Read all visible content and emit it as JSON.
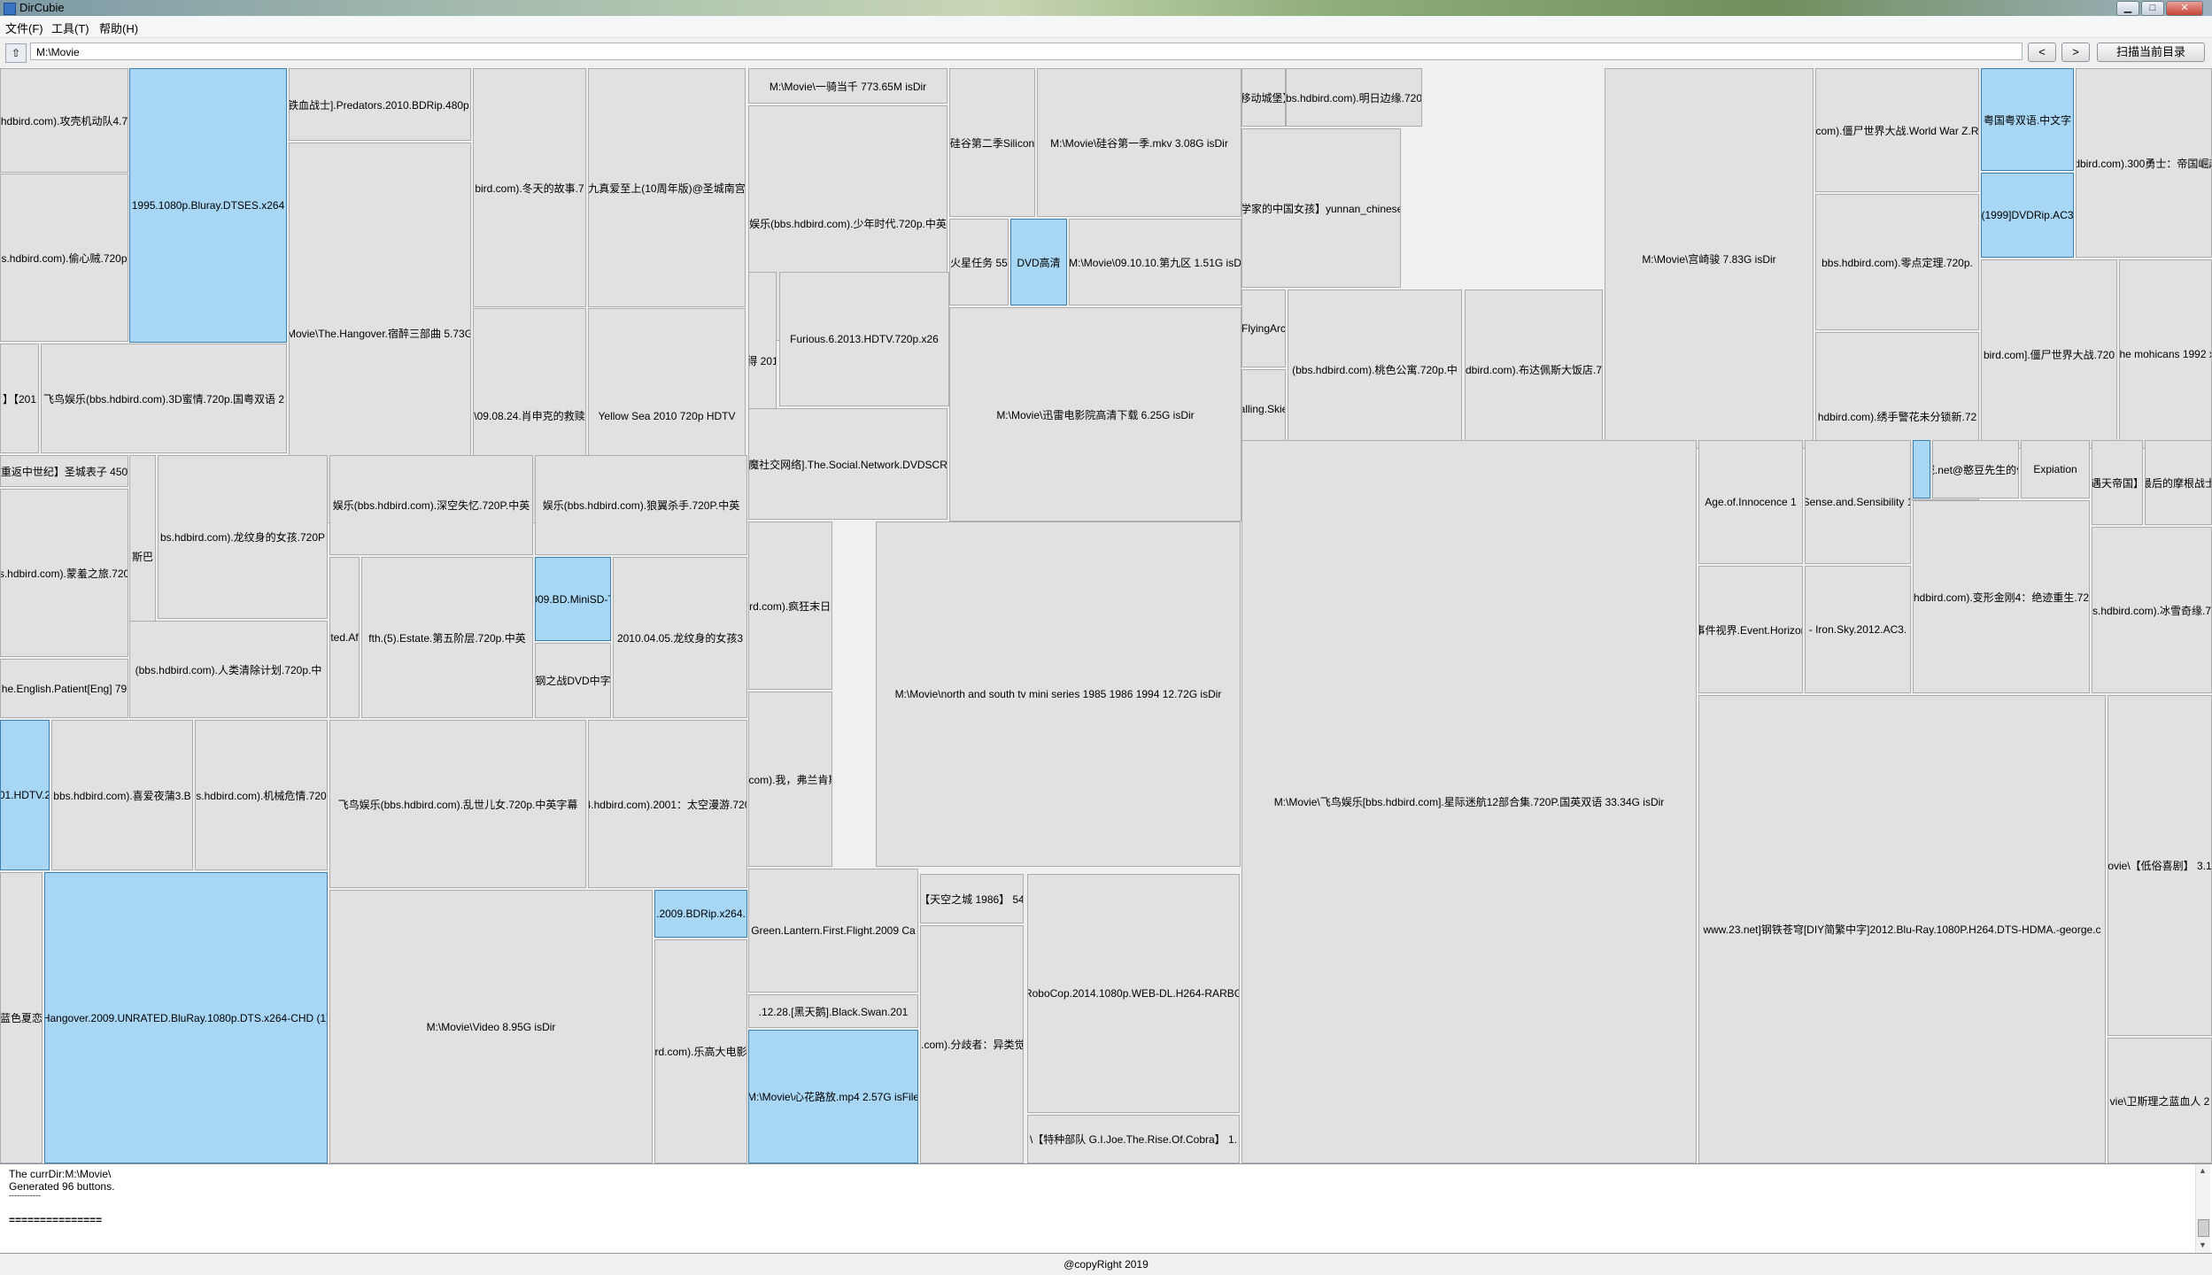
{
  "window": {
    "title": "DirCubie",
    "minimize": "▁",
    "maximize": "□",
    "close": "✕"
  },
  "menu": [
    "文件(F)",
    "工具(T)",
    "帮助(H)"
  ],
  "toolbar": {
    "address_icon": "folder-up-icon",
    "address_value": "M:\\Movie",
    "back_label": "<",
    "forward_label": ">",
    "scan_label": "扫描当前目录"
  },
  "tiles": [
    {
      "label": "hdbird.com).攻壳机动队4.7",
      "selected": false
    },
    {
      "label": "1995.1080p.Bluray.DTSES.x264",
      "selected": true
    },
    {
      "label": "铁血战士].Predators.2010.BDRip.480p.",
      "selected": false
    },
    {
      "label": "bird.com).冬天的故事.7",
      "selected": false
    },
    {
      "label": "九真爱至上(10周年版)@圣城南宫",
      "selected": false
    },
    {
      "label": "M:\\Movie\\一骑当千 773.65M isDir",
      "selected": false
    },
    {
      "label": "Movie\\The.Hangover.宿醉三部曲 5.73G",
      "selected": false
    },
    {
      "label": "娱乐(bbs.hdbird.com).少年时代.720p.中英",
      "selected": false
    },
    {
      "label": "s.hdbird.com).偷心贼.720p",
      "selected": false
    },
    {
      "label": "\\09.08.24.肖申克的救赎",
      "selected": false
    },
    {
      "label": "Yellow Sea 2010 720p HDTV",
      "selected": false
    },
    {
      "label": "】【201",
      "selected": false
    },
    {
      "label": "飞鸟娱乐(bbs.hdbird.com).3D蜜情.720p.国粤双语 2",
      "selected": false
    },
    {
      "label": "重返中世纪】圣城表子 450",
      "selected": false
    },
    {
      "label": "s.hdbird.com).蒙羞之旅.720",
      "selected": false
    },
    {
      "label": "斯巴",
      "selected": false
    },
    {
      "label": "bs.hdbird.com).龙纹身的女孩.720P",
      "selected": false
    },
    {
      "label": "娱乐(bbs.hdbird.com).深空失忆.720P.中英",
      "selected": false
    },
    {
      "label": "娱乐(bbs.hdbird.com).狼翼杀手.720P.中英",
      "selected": false
    },
    {
      "label": "ted.Af",
      "selected": false
    },
    {
      "label": "fth.(5).Estate.第五阶层.720p.中英",
      "selected": false
    },
    {
      "label": "009.BD.MiniSD-T",
      "selected": true
    },
    {
      "label": "2010.04.05.龙纹身的女孩3",
      "selected": false
    },
    {
      "label": "钢之战DVD中字",
      "selected": false
    },
    {
      "label": "(bbs.hdbird.com).人类清除计划.720p.中",
      "selected": false
    },
    {
      "label": "he.English.Patient[Eng] 79",
      "selected": false
    },
    {
      "label": "01.HDTV.2",
      "selected": true
    },
    {
      "label": "bbs.hdbird.com).喜爱夜蒲3.B",
      "selected": false
    },
    {
      "label": "s.hdbird.com).机械危情.720",
      "selected": false
    },
    {
      "label": "飞鸟娱乐(bbs.hdbird.com).乱世儿女.720p.中英字幕",
      "selected": false
    },
    {
      "label": "4.hdbird.com).2001：太空漫游.720",
      "selected": false
    },
    {
      "label": "Hangover.2009.UNRATED.BluRay.1080p.DTS.x264-CHD (1)",
      "selected": true
    },
    {
      "label": "M:\\Movie\\Video 8.95G isDir",
      "selected": false
    },
    {
      "label": ".2009.BDRip.x264.",
      "selected": true
    },
    {
      "label": "rd.com).乐高大电影",
      "selected": false
    },
    {
      "label": "蓝色夏恋",
      "selected": false
    },
    {
      "label": "M:\\Movie\\心花路放.mp4 2.57G isFile",
      "selected": true
    },
    {
      "label": "得 201",
      "selected": false
    },
    {
      "label": "Furious.6.2013.HDTV.720p.x26",
      "selected": false
    },
    {
      "label": "魔社交网络].The.Social.Network.DVDSCR",
      "selected": false
    },
    {
      "label": "hdbird.com).疯狂末日.720",
      "selected": false
    },
    {
      "label": "M:\\Movie\\north and south tv mini series 1985 1986 1994 12.72G isDir",
      "selected": false
    },
    {
      "label": "bird.com).我，弗兰肯斯坦.",
      "selected": false
    },
    {
      "label": "Green.Lantern.First.Flight.2009 Ca",
      "selected": false
    },
    {
      "label": ".12.28.[黑天鹅].Black.Swan.201",
      "selected": false
    },
    {
      "label": "【天空之城 1986】 54",
      "selected": false
    },
    {
      "label": "l.com).分歧者：异类觉",
      "selected": false
    },
    {
      "label": "RoboCop.2014.1080p.WEB-DL.H264-RARBG",
      "selected": false
    },
    {
      "label": "\\【特种部队 G.I.Joe.The.Rise.Of.Cobra】 1.",
      "selected": false
    },
    {
      "label": "硅谷第二季Silicon",
      "selected": false
    },
    {
      "label": "M:\\Movie\\硅谷第一季.mkv 3.08G isDir",
      "selected": false
    },
    {
      "label": "火星任务 55",
      "selected": false
    },
    {
      "label": "DVD高清",
      "selected": true
    },
    {
      "label": "M:\\Movie\\09.10.10.第九区 1.51G isD",
      "selected": false
    },
    {
      "label": "M:\\Movie\\迅雷电影院高清下载 6.25G isDir",
      "selected": false
    },
    {
      "label": "k：别碰他的移动城堡】Haro'sCast",
      "selected": false
    },
    {
      "label": "bbs.hdbird.com).明日边缘.720p",
      "selected": false
    },
    {
      "label": "植物学家的中国女孩】yunnan_chinese_girl",
      "selected": false
    },
    {
      "label": "FlyingArc",
      "selected": false
    },
    {
      "label": "(bbs.hdbird.com).桃色公寓.720p.中",
      "selected": false
    },
    {
      "label": "dbird.com).布达佩斯大饭店.7",
      "selected": false
    },
    {
      "label": "alling.Skie",
      "selected": false
    },
    {
      "label": "M:\\Movie\\宫崎骏 7.83G isDir",
      "selected": false
    },
    {
      "label": "com).僵尸世界大战.World War Z.R",
      "selected": false
    },
    {
      "label": "粤国粤双语.中文字",
      "selected": true
    },
    {
      "label": "hdbird.com).300勇士：帝国崛起",
      "selected": false
    },
    {
      "label": "bbs.hdbird.com).零点定理.720p.",
      "selected": false
    },
    {
      "label": "(1999]DVDRip.AC3",
      "selected": true
    },
    {
      "label": "hdbird.com).绣手警花未分锁新.72",
      "selected": false
    },
    {
      "label": "bird.com].僵尸世界大战.720",
      "selected": false
    },
    {
      "label": "the mohicans 1992 x",
      "selected": false
    },
    {
      "label": "M:\\Movie\\飞鸟娱乐[bbs.hdbird.com].星际迷航12部合集.720P.国英双语 33.34G isDir",
      "selected": false
    },
    {
      "label": "Age.of.Innocence 1",
      "selected": false
    },
    {
      "label": "Sense.and.Sensibility 1",
      "selected": false
    },
    {
      "label": "",
      "selected": true
    },
    {
      "label": "长城.net@憨豆先生的假期",
      "selected": false
    },
    {
      "label": "Expiation",
      "selected": false
    },
    {
      "label": "遇天帝国】",
      "selected": false
    },
    {
      "label": "最后的摩根战士",
      "selected": false
    },
    {
      "label": "事件视界.Event.Horizon",
      "selected": false
    },
    {
      "label": "- Iron.Sky.2012.AC3.",
      "selected": false
    },
    {
      "label": "hdbird.com).变形金刚4：绝迹重生.72",
      "selected": false
    },
    {
      "label": "s.hdbird.com).冰雪奇缘.7",
      "selected": false
    },
    {
      "label": "www.23.net]钢铁苍穹[DIY简繁中字]2012.Blu-Ray.1080P.H264.DTS-HDMA.-george.c",
      "selected": false
    },
    {
      "label": "ovie\\【低俗喜剧】 3.1",
      "selected": false
    },
    {
      "label": "vie\\卫斯理之蓝血人 2",
      "selected": false
    }
  ],
  "log": {
    "lines": [
      "The currDir:M:\\Movie\\",
      "Generated 96 buttons.",
      "------------",
      "",
      "==============="
    ]
  },
  "status": "@copyRight 2019"
}
